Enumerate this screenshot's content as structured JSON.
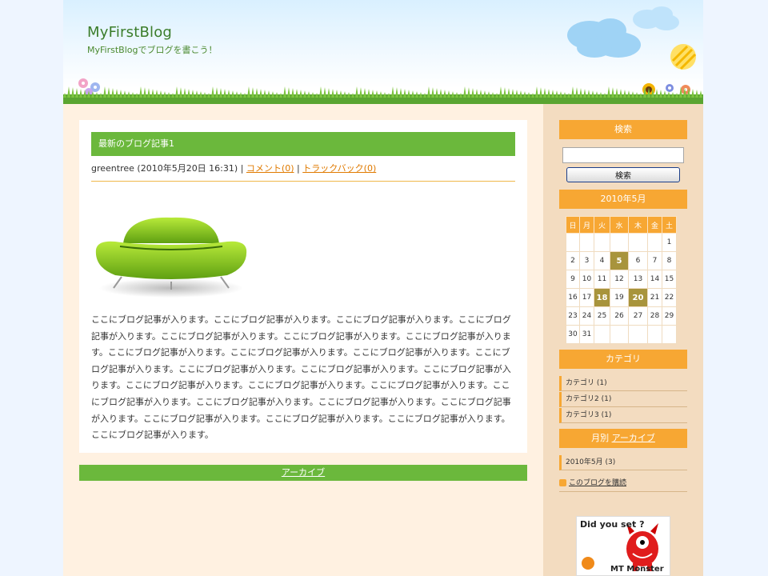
{
  "site": {
    "title": "MyFirstBlog",
    "description": "MyFirstBlogでブログを書こう！"
  },
  "post": {
    "title": "最新のブログ記事1",
    "author": "greentree",
    "date_text": "(2010年5月20日 16:31)",
    "sep1": "|",
    "comment_link": "コメント(0)",
    "sep2": "|",
    "trackback_link": "トラックバック(0)",
    "image_icon": "green-sofa-image",
    "body": "ここにブログ記事が入ります。ここにブログ記事が入ります。ここにブログ記事が入ります。ここにブログ記事が入ります。ここにブログ記事が入ります。ここにブログ記事が入ります。ここにブログ記事が入ります。ここにブログ記事が入ります。ここにブログ記事が入ります。ここにブログ記事が入ります。ここにブログ記事が入ります。ここにブログ記事が入ります。ここにブログ記事が入ります。ここにブログ記事が入ります。ここにブログ記事が入ります。ここにブログ記事が入ります。ここにブログ記事が入ります。ここにブログ記事が入ります。ここにブログ記事が入ります。ここにブログ記事が入ります。ここにブログ記事が入ります。ここにブログ記事が入ります。ここにブログ記事が入ります。ここにブログ記事が入ります。ここにブログ記事が入ります。"
  },
  "archive_link": "アーカイブ",
  "sidebar": {
    "search": {
      "heading": "検索",
      "input_value": "",
      "button_label": "検索"
    },
    "calendar": {
      "heading": "2010年5月",
      "weekdays": [
        "日",
        "月",
        "火",
        "水",
        "木",
        "金",
        "土"
      ],
      "weeks": [
        [
          "",
          "",
          "",
          "",
          "",
          "",
          "1"
        ],
        [
          "2",
          "3",
          "4",
          "5",
          "6",
          "7",
          "8"
        ],
        [
          "9",
          "10",
          "11",
          "12",
          "13",
          "14",
          "15"
        ],
        [
          "16",
          "17",
          "18",
          "19",
          "20",
          "21",
          "22"
        ],
        [
          "23",
          "24",
          "25",
          "26",
          "27",
          "28",
          "29"
        ],
        [
          "30",
          "31",
          "",
          "",
          "",
          "",
          ""
        ]
      ],
      "highlighted": [
        "5",
        "18",
        "20"
      ]
    },
    "categories": {
      "heading": "カテゴリ",
      "items": [
        "カテゴリ (1)",
        "カテゴリ2 (1)",
        "カテゴリ3 (1)"
      ]
    },
    "monthly": {
      "heading_prefix": "月別",
      "heading_link": "アーカイブ",
      "items": [
        "2010年5月 (3)"
      ]
    },
    "subscribe": {
      "label": "このブログを購読",
      "icon": "rss-feed-icon"
    },
    "badge": {
      "question": "Did you set ?",
      "name": "MT Monster",
      "icon": "mt-monster-icon"
    }
  },
  "colors": {
    "title_green": "#3b7d2a",
    "post_bar_green": "#6bb83c",
    "sidebar_orange": "#f7a733",
    "calendar_highlight": "#a8943c",
    "link_orange": "#e07a00"
  }
}
